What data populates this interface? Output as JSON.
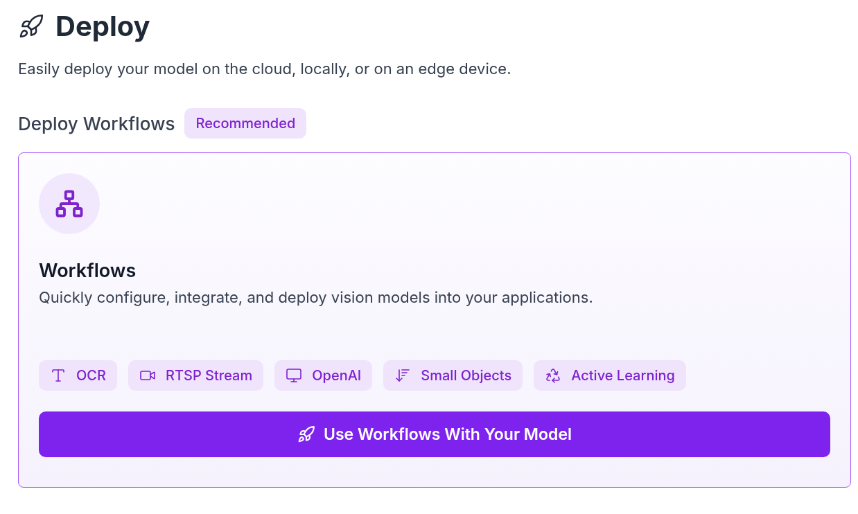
{
  "header": {
    "title": "Deploy",
    "subtitle": "Easily deploy your model on the cloud, locally, or on an edge device."
  },
  "section": {
    "title": "Deploy Workflows",
    "badge": "Recommended"
  },
  "card": {
    "title": "Workflows",
    "description": "Quickly configure, integrate, and deploy vision models into your applications.",
    "tags": [
      {
        "kind": "text",
        "label": "OCR"
      },
      {
        "kind": "video",
        "label": "RTSP Stream"
      },
      {
        "kind": "computer",
        "label": "OpenAI"
      },
      {
        "kind": "sort",
        "label": "Small Objects"
      },
      {
        "kind": "recycle",
        "label": "Active Learning"
      }
    ],
    "button": "Use Workflows With Your Model"
  }
}
